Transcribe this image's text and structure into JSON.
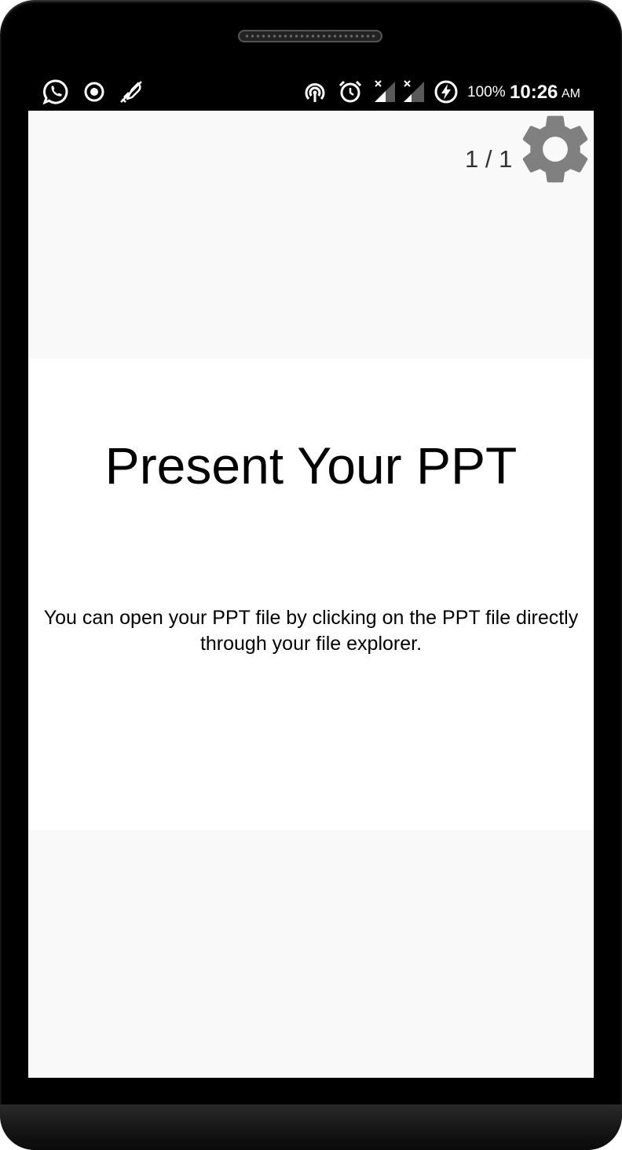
{
  "status_bar": {
    "left_icons": [
      "whatsapp-icon",
      "record-icon",
      "mute-icon"
    ],
    "right_icons": [
      "hotspot-icon",
      "alarm-icon",
      "signal-1-icon",
      "signal-2-icon",
      "battery-charging-icon"
    ],
    "battery_percent": "100%",
    "time": "10:26",
    "ampm": "AM"
  },
  "viewer": {
    "page_counter": "1 / 1",
    "settings_icon": "gear-icon"
  },
  "slide": {
    "title": "Present Your PPT",
    "body": "You can open your PPT file by clicking on the PPT file directly through your file explorer."
  },
  "colors": {
    "frame": "#000000",
    "screen_background": "#f9f9f9",
    "slide_background": "#ffffff",
    "gear": "#808080"
  }
}
